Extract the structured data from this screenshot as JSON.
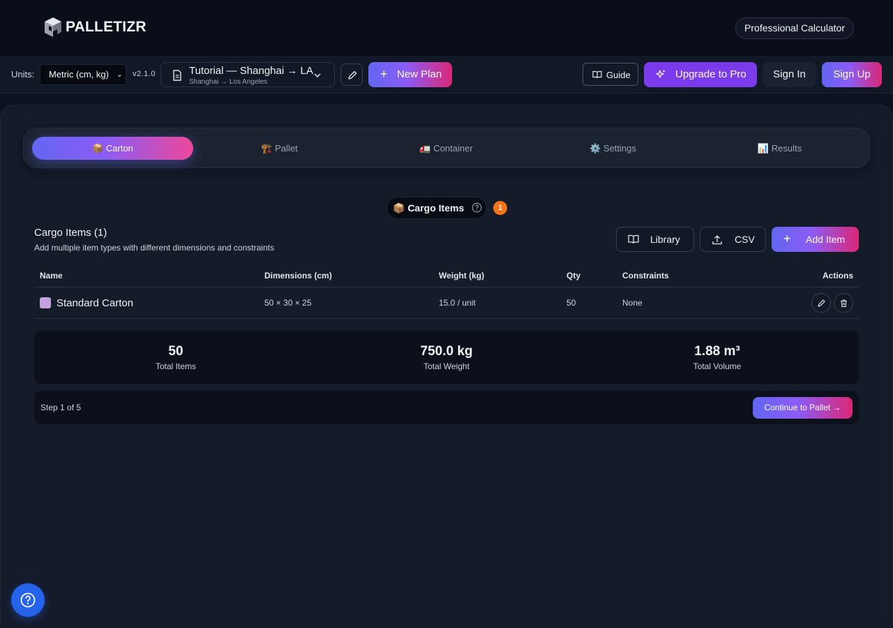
{
  "header": {
    "brand": "PALLETIZR",
    "badge": "Professional Calculator"
  },
  "toolbar": {
    "units_label": "Units:",
    "units_value": "Metric (cm, kg)",
    "version": "v2.1.0",
    "plan_title": "Tutorial — Shanghai → LA",
    "plan_subtitle": "Shanghai → Los Angeles",
    "new_plan": "New Plan",
    "guide": "Guide",
    "upgrade": "Upgrade to Pro",
    "sign_in": "Sign In",
    "sign_up": "Sign Up"
  },
  "tabs": [
    {
      "icon": "📦",
      "label": "Carton",
      "active": true
    },
    {
      "icon": "🏗️",
      "label": "Pallet",
      "active": false
    },
    {
      "icon": "🚛",
      "label": "Container",
      "active": false
    },
    {
      "icon": "⚙️",
      "label": "Settings",
      "active": false
    },
    {
      "icon": "📊",
      "label": "Results",
      "active": false
    }
  ],
  "section": {
    "pill_label": "📦 Cargo Items",
    "count": "1",
    "heading": "Cargo Items (1)",
    "description": "Add multiple item types with different dimensions and constraints",
    "library": "Library",
    "csv": "CSV",
    "add_item": "Add Item"
  },
  "table": {
    "headers": {
      "name": "Name",
      "dimensions": "Dimensions (cm)",
      "weight": "Weight (kg)",
      "qty": "Qty",
      "constraints": "Constraints",
      "actions": "Actions"
    },
    "rows": [
      {
        "color": "#c4a0dc",
        "name": "Standard Carton",
        "dimensions": "50 × 30 × 25",
        "weight": "15.0 / unit",
        "qty": "50",
        "constraints": "None"
      }
    ]
  },
  "totals": [
    {
      "value": "50",
      "label": "Total Items"
    },
    {
      "value": "750.0 kg",
      "label": "Total Weight"
    },
    {
      "value": "1.88 m³",
      "label": "Total Volume"
    }
  ],
  "footer": {
    "step": "Step 1 of 5",
    "continue": "Continue to Pallet →"
  },
  "icons": {
    "logo": "palletizr-cube-logo",
    "help": "help-circle-icon",
    "edit": "pencil-icon",
    "delete": "trash-icon"
  },
  "colors": {
    "accent_gradient_start": "#6366f1",
    "accent_gradient_end": "#ec4899",
    "upgrade": "#7c3aed",
    "badge": "#f97316",
    "help": "#2563eb"
  }
}
